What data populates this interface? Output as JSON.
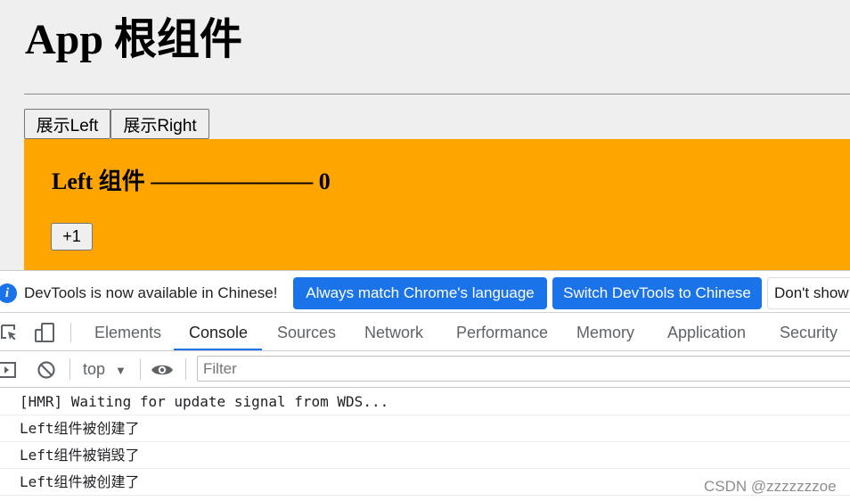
{
  "page": {
    "title": "App 根组件",
    "buttons": {
      "show_left": "展示Left",
      "show_right": "展示Right"
    },
    "left_component": {
      "heading": "Left 组件 ——————— 0",
      "plus_button": "+1",
      "background_color": "#ffa500"
    }
  },
  "devtools": {
    "infobar": {
      "message": "DevTools is now available in Chinese!",
      "buttons": {
        "always_match": "Always match Chrome's language",
        "switch": "Switch DevTools to Chinese",
        "dont_show": "Don't show again"
      }
    },
    "tabs": [
      "Elements",
      "Console",
      "Sources",
      "Network",
      "Performance",
      "Memory",
      "Application",
      "Security"
    ],
    "active_tab": "Console",
    "console_toolbar": {
      "context": "top",
      "filter_placeholder": "Filter"
    },
    "console_messages": [
      "[HMR] Waiting for update signal from WDS...",
      "Left组件被创建了",
      "Left组件被销毁了",
      "Left组件被创建了"
    ],
    "accent_color": "#1a73e8"
  },
  "watermark": "CSDN @zzzzzzzoe"
}
